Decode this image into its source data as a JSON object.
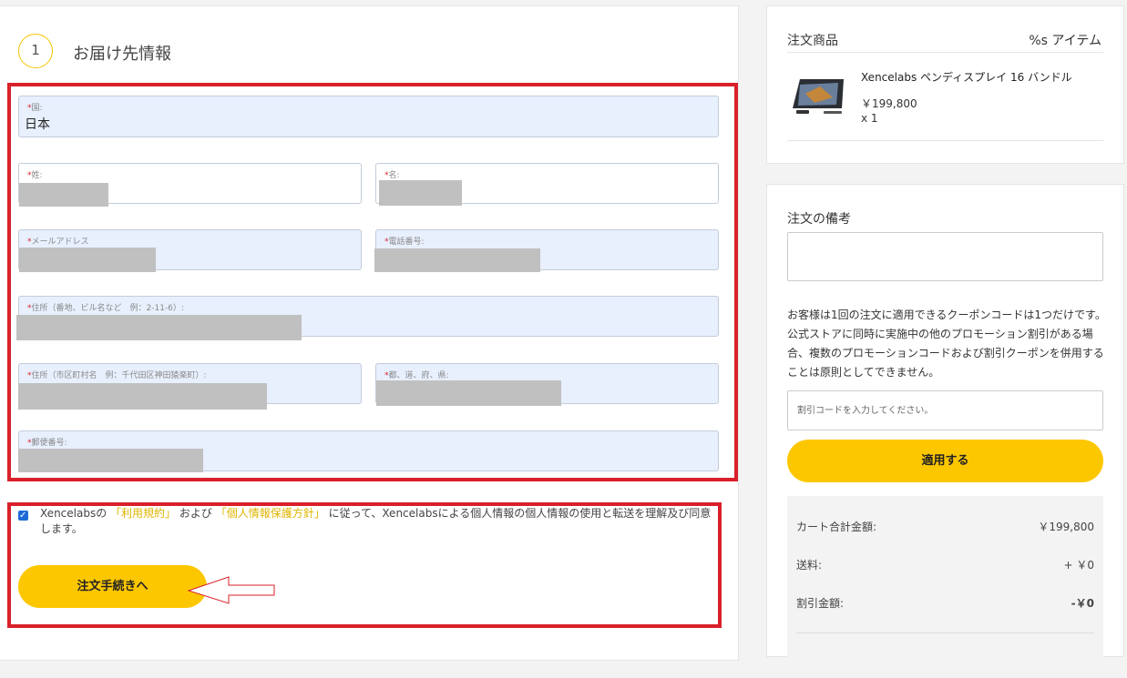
{
  "step": {
    "number": "1",
    "title": "お届け先情報"
  },
  "form": {
    "country_label": "国:",
    "country_value": "日本",
    "last_name_label": "姓:",
    "first_name_label": "名:",
    "email_label": "メールアドレス",
    "phone_label": "電話番号:",
    "address1_label": "住所（番地、ビル名など　例：2-11-6）:",
    "address2_label": "住所（市区町村名　例：千代田区神田猿楽町）:",
    "prefecture_label": "都、道、府、県:",
    "zip_label": "郵便番号:"
  },
  "consent": {
    "prefix": "Xencelabsの",
    "terms_link": "「利用規約」",
    "and": "および",
    "privacy_link": "「個人情報保護方針」",
    "suffix": "に従って、Xencelabsによる個人情報の個人情報の使用と転送を理解及び同意します。"
  },
  "checkout_button": "注文手続きへ",
  "order": {
    "title": "注文商品",
    "count": "%s アイテム",
    "product_name": "Xencelabs ペンディスプレイ 16 バンドル",
    "product_price": "￥199,800",
    "product_qty": "x 1"
  },
  "notes": {
    "title": "注文の備考",
    "coupon_notice": "お客様は1回の注文に適用できるクーポンコードは1つだけです。公式ストアに同時に実施中の他のプロモーション割引がある場合、複数のプロモーションコードおよび割引クーポンを併用することは原則としてできません。",
    "coupon_placeholder": "割引コードを入力してください。",
    "apply_button": "適用する"
  },
  "summary": {
    "cart_total_label": "カート合計金額:",
    "cart_total_value": "￥199,800",
    "shipping_label": "送料:",
    "shipping_value": "+ ￥0",
    "discount_label": "割引金額:",
    "discount_value": "-￥0"
  },
  "colors": {
    "accent": "#fdc700",
    "highlight_border": "#d9202a",
    "field_bg": "#e8f0fe"
  }
}
